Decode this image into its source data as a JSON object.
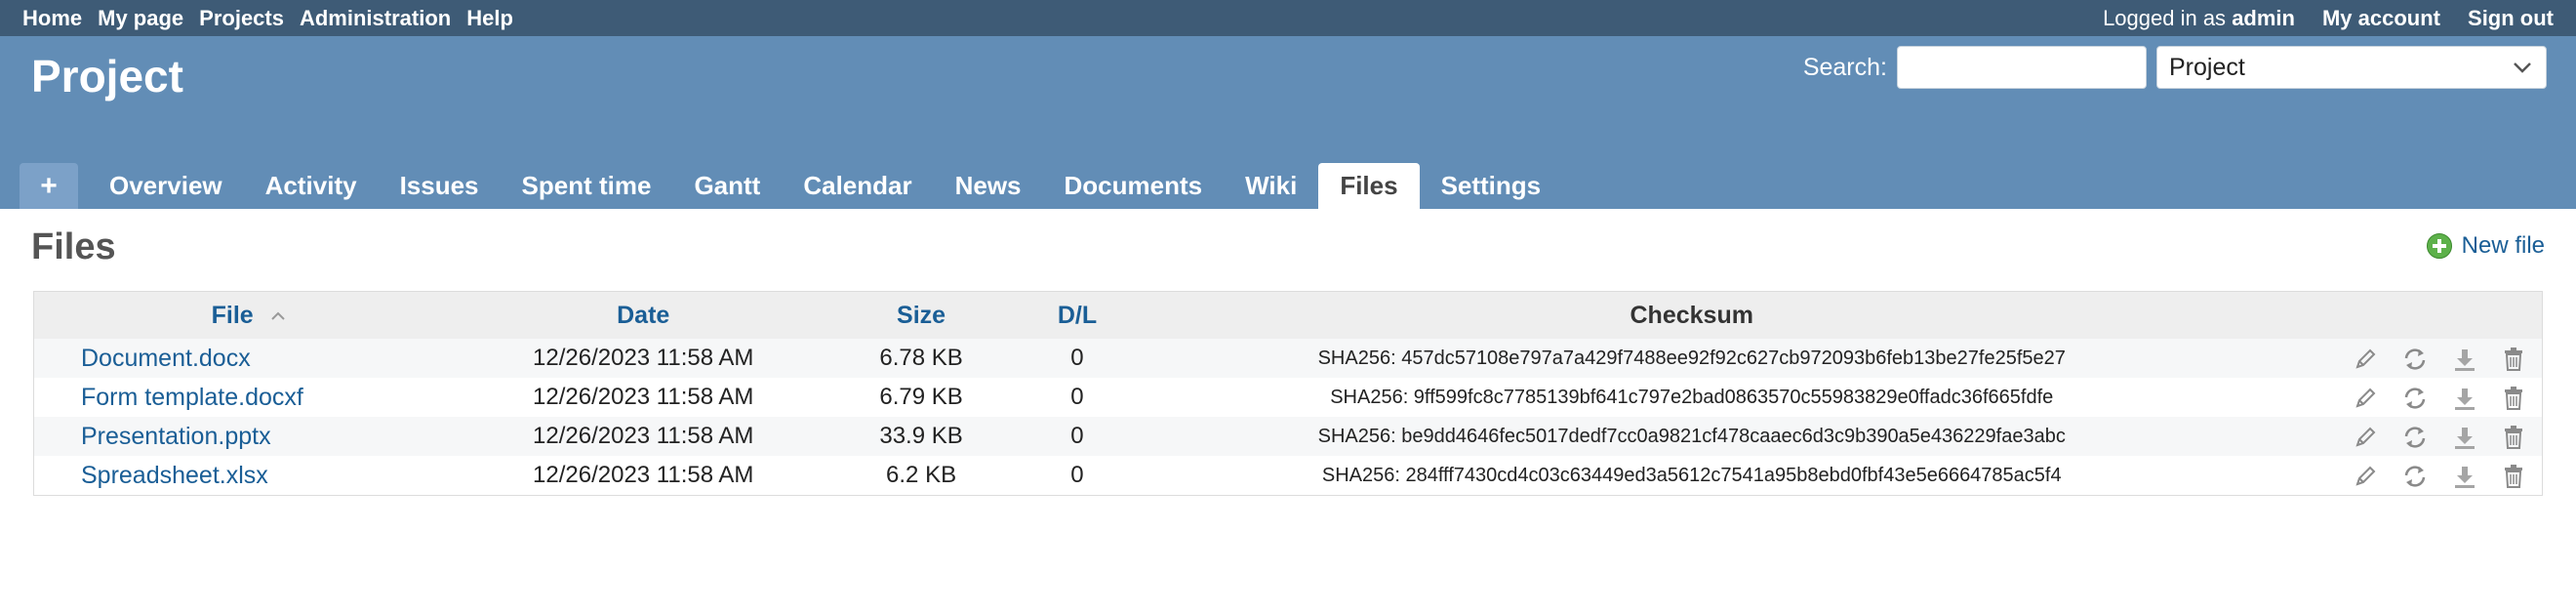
{
  "top_menu": {
    "links": [
      "Home",
      "My page",
      "Projects",
      "Administration",
      "Help"
    ],
    "logged_in_prefix": "Logged in as",
    "user": "admin",
    "my_account": "My account",
    "sign_out": "Sign out"
  },
  "header": {
    "project_title": "Project",
    "search_label": "Search:",
    "search_value": "",
    "scope_select": "Project"
  },
  "main_menu": {
    "new_tab": "+",
    "tabs": [
      "Overview",
      "Activity",
      "Issues",
      "Spent time",
      "Gantt",
      "Calendar",
      "News",
      "Documents",
      "Wiki",
      "Files",
      "Settings"
    ],
    "selected": "Files"
  },
  "content": {
    "title": "Files",
    "new_file_label": "New file",
    "table": {
      "columns": [
        "File",
        "Date",
        "Size",
        "D/L",
        "Checksum"
      ],
      "sorted_column": "File",
      "rows": [
        {
          "file": "Document.docx",
          "date": "12/26/2023 11:58 AM",
          "size": "6.78 KB",
          "dl": "0",
          "checksum": "SHA256: 457dc57108e797a7a429f7488ee92f92c627cb972093b6feb13be27fe25f5e27"
        },
        {
          "file": "Form template.docxf",
          "date": "12/26/2023 11:58 AM",
          "size": "6.79 KB",
          "dl": "0",
          "checksum": "SHA256: 9ff599fc8c7785139bf641c797e2bad0863570c55983829e0ffadc36f665fdfe"
        },
        {
          "file": "Presentation.pptx",
          "date": "12/26/2023 11:58 AM",
          "size": "33.9 KB",
          "dl": "0",
          "checksum": "SHA256: be9dd4646fec5017dedf7cc0a9821cf478caaec6d3c9b390a5e436229fae3abc"
        },
        {
          "file": "Spreadsheet.xlsx",
          "date": "12/26/2023 11:58 AM",
          "size": "6.2 KB",
          "dl": "0",
          "checksum": "SHA256: 284fff7430cd4c03c63449ed3a5612c7541a95b8ebd0fbf43e5e6664785ac5f4"
        }
      ]
    }
  },
  "colors": {
    "top_bar": "#3e5b76",
    "header": "#628db6",
    "link": "#1a5e96"
  },
  "icons": [
    "edit-icon",
    "refresh-icon",
    "download-icon",
    "delete-icon",
    "add-icon",
    "sort-ascending-icon",
    "chevron-down-icon"
  ]
}
